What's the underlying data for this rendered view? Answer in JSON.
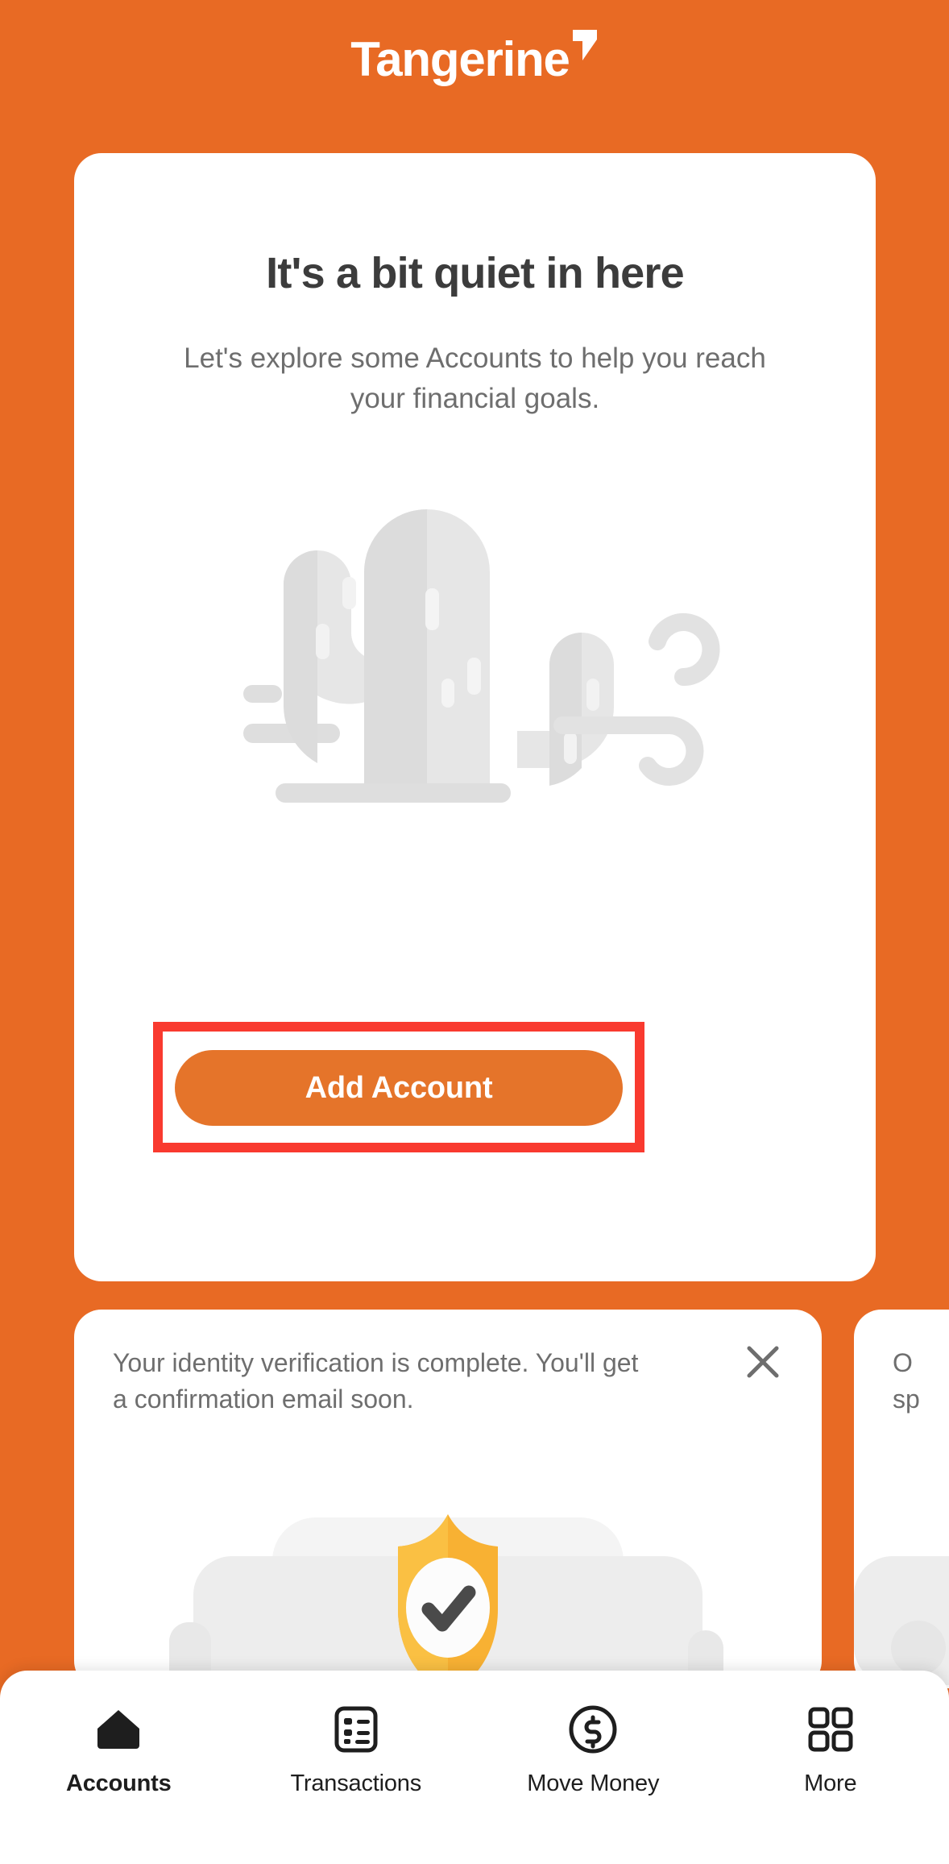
{
  "brand": {
    "logo_text": "Tangerine",
    "logo_mark": "triangle-leaf-mark",
    "orange": "#E86A24",
    "button_orange": "#E5742A",
    "highlight_red": "#F93A2F",
    "shield_yellow": "#F8B133"
  },
  "empty_state": {
    "title": "It's a bit quiet in here",
    "subtitle": "Let's explore some Accounts to help you reach your financial goals.",
    "illustration": "cactus-illustration",
    "cta_label": "Add Account"
  },
  "notification": {
    "message": "Your identity verification is complete. You'll get a confirmation email soon.",
    "close_icon": "close-icon",
    "illustration": "shield-check-illustration"
  },
  "peek_card": {
    "line1": "O",
    "line2": "sp"
  },
  "bottom_nav": {
    "items": [
      {
        "label": "Accounts",
        "icon": "home-icon",
        "active": true
      },
      {
        "label": "Transactions",
        "icon": "list-document-icon",
        "active": false
      },
      {
        "label": "Move Money",
        "icon": "dollar-circle-icon",
        "active": false
      },
      {
        "label": "More",
        "icon": "grid-icon",
        "active": false
      }
    ]
  }
}
